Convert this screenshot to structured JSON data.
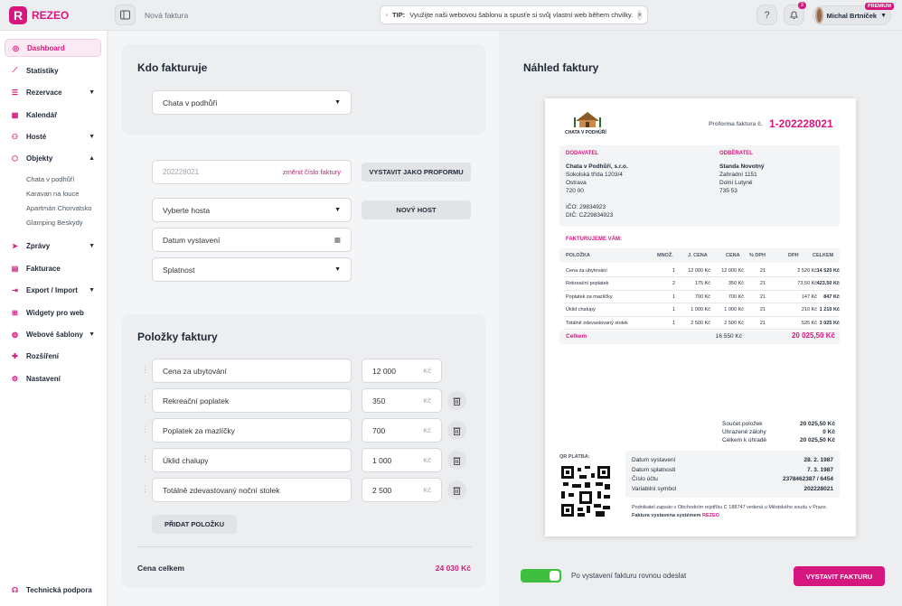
{
  "app": {
    "name": "REZEO",
    "logo_letter": "R"
  },
  "topbar": {
    "breadcrumb": "Nová faktura",
    "tip_label": "TIP:",
    "tip_text": "Využijte naši webovou šablonu a spusťe si svůj vlastní web během chvilky.",
    "notifications_count": "3",
    "user_name": "Michal Brtníček",
    "user_badge": "PREMIUM",
    "accent_color": "#d6177f"
  },
  "sidebar": {
    "items": [
      {
        "label": "Dashboard",
        "icon": "palette-icon"
      },
      {
        "label": "Statistiky",
        "icon": "chart-icon"
      },
      {
        "label": "Rezervace",
        "icon": "list-icon"
      },
      {
        "label": "Kalendář",
        "icon": "calendar-icon"
      },
      {
        "label": "Hosté",
        "icon": "users-icon"
      },
      {
        "label": "Objekty",
        "icon": "cube-icon"
      },
      {
        "label": "Zprávy",
        "icon": "send-icon"
      },
      {
        "label": "Fakturace",
        "icon": "document-icon"
      },
      {
        "label": "Export / Import",
        "icon": "export-icon"
      },
      {
        "label": "Widgety pro web",
        "icon": "widget-icon"
      },
      {
        "label": "Webové šablony",
        "icon": "globe-icon"
      },
      {
        "label": "Rozšíření",
        "icon": "puzzle-icon"
      },
      {
        "label": "Nastavení",
        "icon": "gear-icon"
      }
    ],
    "sub_items": [
      "Chata v podhůří",
      "Karavan na louce",
      "Apartmán Chorvatsko",
      "Glamping Beskydy"
    ],
    "support": "Technická podpora"
  },
  "form": {
    "who_title": "Kdo fakturuje",
    "issuer_select": "Chata v podhůří",
    "invoice_number": "202228021",
    "change_number": "změnit číslo faktury",
    "proforma_button": "VYSTAVIT JAKO PROFORMU",
    "guest_select": "Vyberte hosta",
    "new_guest_button": "NOVÝ HOST",
    "issue_date_placeholder": "Datum vystavení",
    "due_select": "Splatnost",
    "items_title": "Položky faktury",
    "items": [
      {
        "name": "Cena za ubytování",
        "price": "12 000"
      },
      {
        "name": "Rekreační poplatek",
        "price": "350"
      },
      {
        "name": "Poplatek za mazlíčky",
        "price": "700"
      },
      {
        "name": "Úklid chalupy",
        "price": "1 000"
      },
      {
        "name": "Totálně zdevastovaný noční stolek",
        "price": "2 500"
      }
    ],
    "currency": "Kč",
    "add_item_button": "PŘIDAT POLOŽKU",
    "total_label": "Cena celkem",
    "total_value": "24 030 Kč"
  },
  "preview": {
    "title": "Náhled faktury",
    "logo_text": "CHATA V PODHŮŘÍ",
    "proforma_label": "Proforma faktura č.",
    "proforma_number": "1-202228021",
    "supplier_label": "DODAVATEL",
    "supplier_lines": [
      "Chata v Podhůří, s.r.o.",
      "Sokolská třída 1203/4",
      "Ostrava",
      "720 00"
    ],
    "supplier_ids": [
      "IČO: 29834923",
      "DIČ: CZ29834923"
    ],
    "customer_label": "ODBĚRATEL",
    "customer_lines": [
      "Standa Novotný",
      "Zahradní 1151",
      "Dolní Lutyně",
      "735 53"
    ],
    "invoicing_label": "FAKTURUJEME VÁM:",
    "table_headers": [
      "POLOŽKA",
      "MNOŽ.",
      "J. CENA",
      "CENA",
      "% DPH",
      "DPH",
      "CELKEM"
    ],
    "table_rows": [
      [
        "Cena za ubytování",
        "1",
        "12 000 Kč",
        "12 000 Kč",
        "21",
        "2 520 Kč",
        "14 520 Kč"
      ],
      [
        "Rekreační poplatek",
        "2",
        "175 Kč",
        "350 Kč",
        "21",
        "73,50 Kč",
        "423,50 Kč"
      ],
      [
        "Poplatek za mazlíčky",
        "1",
        "700 Kč",
        "700 Kč",
        "21",
        "147 Kč",
        "847 Kč"
      ],
      [
        "Úklid chalupy",
        "1",
        "1 000 Kč",
        "1 000 Kč",
        "21",
        "210 Kč",
        "1 210 Kč"
      ],
      [
        "Totálně zdevastovaný stolek",
        "1",
        "2 500 Kč",
        "2 500 Kč",
        "21",
        "525 Kč",
        "3 025 Kč"
      ]
    ],
    "sum_label": "Celkem",
    "sum_net": "16 550 Kč",
    "sum_total": "20 025,50 Kč",
    "summary": [
      {
        "label": "Součet položek",
        "value": "20 025,50 Kč"
      },
      {
        "label": "Uhrazené zálohy",
        "value": "0 Kč"
      },
      {
        "label": "Celkem k úhradě",
        "value": "20 025,50 Kč"
      }
    ],
    "qr_label": "QR PLATBA:",
    "payment": [
      {
        "label": "Datum vystavení",
        "value": "28. 2. 1987"
      },
      {
        "label": "Datum splatnosti",
        "value": "7. 3. 1987"
      },
      {
        "label": "Číslo účtu",
        "value": "2378462387 / 6454"
      },
      {
        "label": "Variabilní symbol",
        "value": "202228021"
      }
    ],
    "footer_text": "Podnikatel zapsán v Obchodním rejstříku C 188747 vedená u Městského soudu v Praze.",
    "footer_bold": "Faktura vystavena systémem",
    "footer_brand": "REZEO"
  },
  "bottom": {
    "toggle_label": "Po vystavení fakturu rovnou odeslat",
    "submit_button": "VYSTAVIT FAKTURU"
  }
}
